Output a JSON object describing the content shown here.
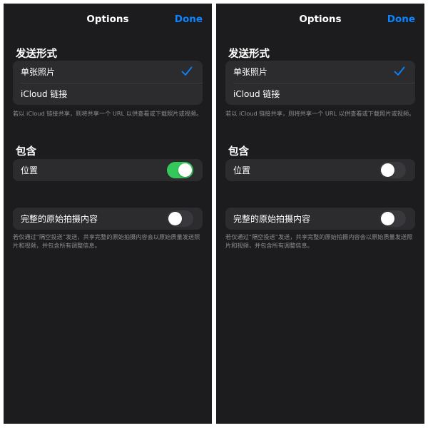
{
  "left": {
    "nav": {
      "title": "Options",
      "done": "Done"
    },
    "send_section": {
      "title": "发送形式",
      "options": [
        "单张照片",
        "iCloud 链接"
      ],
      "selected": "单张照片",
      "footnote": "若以 iCloud 链接共享，则将共享一个 URL 以供查看或下载照片或视频。"
    },
    "include_section": {
      "title": "包含",
      "location_label": "位置",
      "location_on": true
    },
    "original": {
      "label": "完整的原始拍摄内容",
      "on": false,
      "footnote": "若仅通过“隔空投送”发送，共享完整的原始拍摄内容会以原始质量发送照片和视频，并包含所有调整信息。"
    }
  },
  "right": {
    "nav": {
      "title": "Options",
      "done": "Done"
    },
    "send_section": {
      "title": "发送形式",
      "options": [
        "单张照片",
        "iCloud 链接"
      ],
      "selected": "单张照片",
      "footnote": "若以 iCloud 链接共享，则将共享一个 URL 以供查看或下载照片或视频。"
    },
    "include_section": {
      "title": "包含",
      "location_label": "位置",
      "location_on": false
    },
    "original": {
      "label": "完整的原始拍摄内容",
      "on": false,
      "footnote": "若仅通过“隔空投送”发送，共享完整的原始拍摄内容会以原始质量发送照片和视频，并包含所有调整信息。"
    }
  },
  "colors": {
    "background": "#1c1c1e",
    "group": "#2c2c2e",
    "accent": "#0a84ff",
    "toggle_on": "#34c759",
    "toggle_off": "#39393d",
    "footnote": "#8e8e93"
  }
}
